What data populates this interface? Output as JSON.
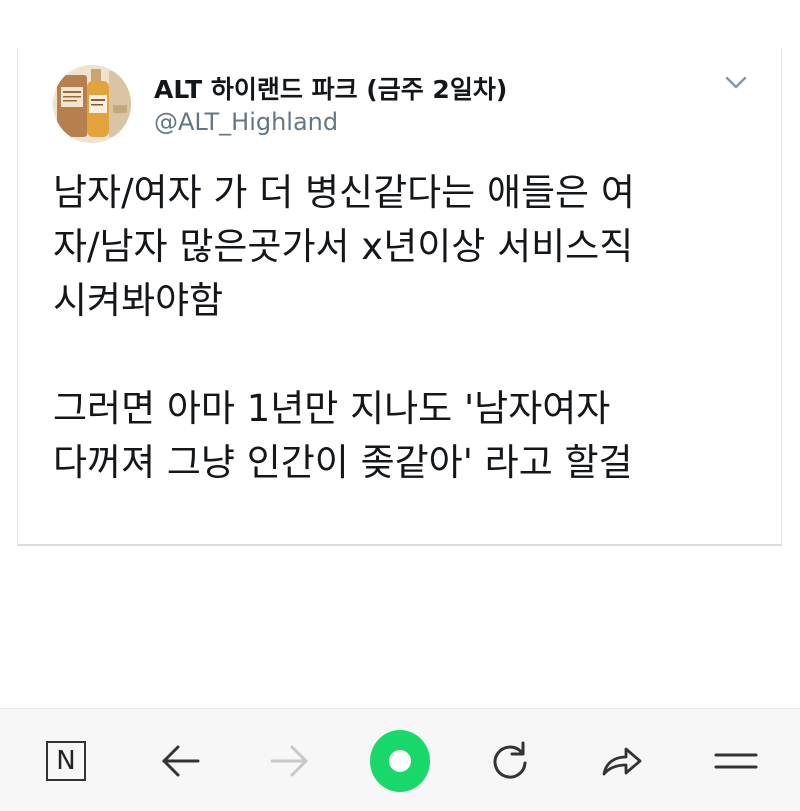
{
  "tweet": {
    "display_name": "ALT 하이랜드 파크 (금주 2일차)",
    "handle": "@ALT_Highland",
    "paragraphs": [
      "남자/여자 가 더 병신같다는 애들은 여\n자/남자 많은곳가서 x년이상 서비스직\n시켜봐야함",
      "그러면 아마 1년만 지나도 '남자여자\n다꺼져 그냥 인간이 좆같아' 라고 할걸"
    ],
    "menu_icon": "chevron-down-icon"
  },
  "browser_toolbar": {
    "home_label": "N",
    "icons": [
      "naver-home-icon",
      "back-arrow-icon",
      "forward-arrow-icon",
      "green-dot-icon",
      "refresh-icon",
      "share-icon",
      "menu-icon"
    ],
    "accent_color": "#19d86a",
    "disabled_color": "#c8c8c8",
    "icon_color": "#333333"
  }
}
